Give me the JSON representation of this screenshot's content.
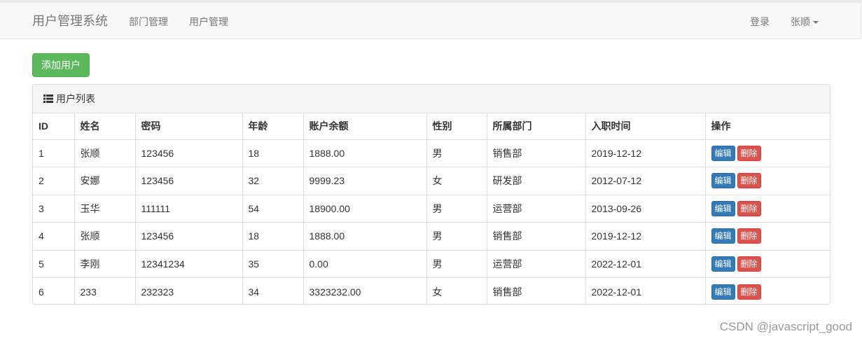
{
  "navbar": {
    "brand": "用户管理系统",
    "links": [
      "部门管理",
      "用户管理"
    ],
    "login": "登录",
    "user": "张顺"
  },
  "actions": {
    "add_user": "添加用户"
  },
  "panel": {
    "title": "用户列表"
  },
  "table": {
    "headers": [
      "ID",
      "姓名",
      "密码",
      "年龄",
      "账户余额",
      "性别",
      "所属部门",
      "入职时间",
      "操作"
    ],
    "rows": [
      [
        "1",
        "张顺",
        "123456",
        "18",
        "1888.00",
        "男",
        "销售部",
        "2019-12-12"
      ],
      [
        "2",
        "安娜",
        "123456",
        "32",
        "9999.23",
        "女",
        "研发部",
        "2012-07-12"
      ],
      [
        "3",
        "玉华",
        "111111",
        "54",
        "18900.00",
        "男",
        "运营部",
        "2013-09-26"
      ],
      [
        "4",
        "张顺",
        "123456",
        "18",
        "1888.00",
        "男",
        "销售部",
        "2019-12-12"
      ],
      [
        "5",
        "李刚",
        "12341234",
        "35",
        "0.00",
        "男",
        "运营部",
        "2022-12-01"
      ],
      [
        "6",
        "233",
        "232323",
        "34",
        "3323232.00",
        "女",
        "销售部",
        "2022-12-01"
      ]
    ],
    "edit_label": "编辑",
    "delete_label": "删除"
  },
  "watermark": "CSDN @javascript_good",
  "colors": {
    "primary": "#337ab7",
    "success": "#5cb85c",
    "danger": "#d9534f"
  }
}
